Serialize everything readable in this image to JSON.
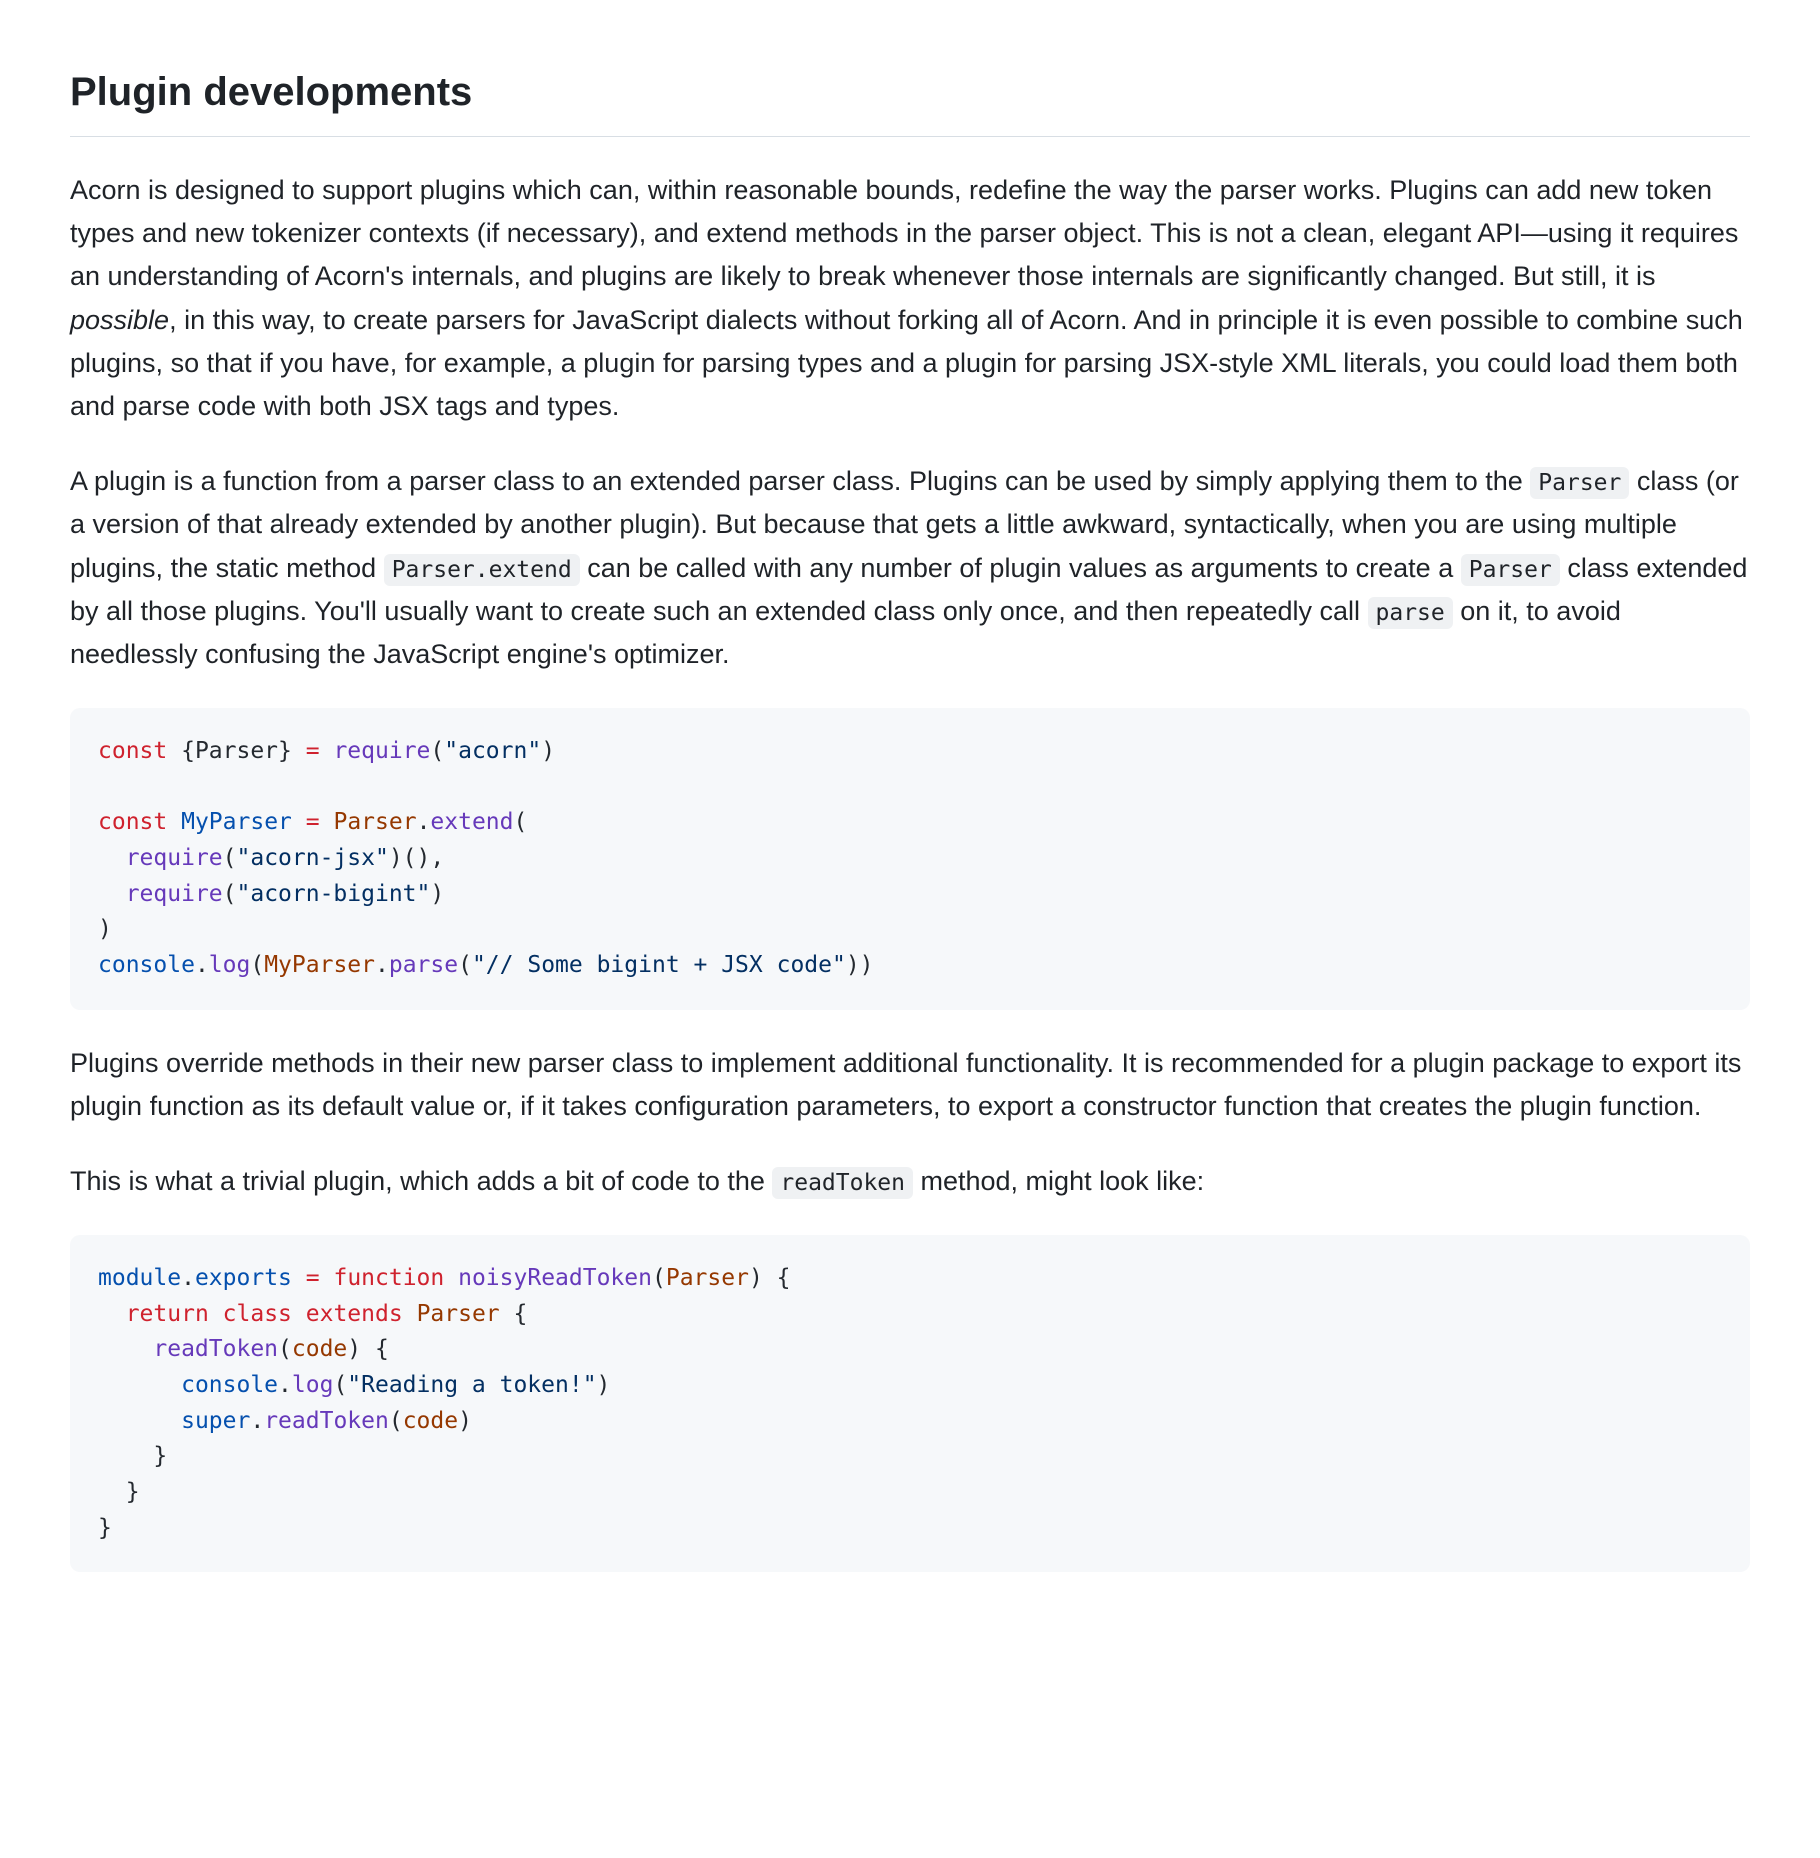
{
  "heading": "Plugin developments",
  "p1a": "Acorn is designed to support plugins which can, within reasonable bounds, redefine the way the parser works. Plugins can add new token types and new tokenizer contexts (if necessary), and extend methods in the parser object. This is not a clean, elegant API—using it requires an understanding of Acorn's internals, and plugins are likely to break whenever those internals are significantly changed. But still, it is ",
  "p1em": "possible",
  "p1b": ", in this way, to create parsers for JavaScript dialects without forking all of Acorn. And in principle it is even possible to combine such plugins, so that if you have, for example, a plugin for parsing types and a plugin for parsing JSX-style XML literals, you could load them both and parse code with both JSX tags and types.",
  "p2a": "A plugin is a function from a parser class to an extended parser class. Plugins can be used by simply applying them to the ",
  "p2code1": "Parser",
  "p2b": " class (or a version of that already extended by another plugin). But because that gets a little awkward, syntactically, when you are using multiple plugins, the static method ",
  "p2code2": "Parser.extend",
  "p2c": " can be called with any number of plugin values as arguments to create a ",
  "p2code3": "Parser",
  "p2d": " class extended by all those plugins. You'll usually want to create such an extended class only once, and then repeatedly call ",
  "p2code4": "parse",
  "p2e": " on it, to avoid needlessly confusing the JavaScript engine's optimizer.",
  "code1": {
    "t0": "const",
    "t1": " {Parser} ",
    "t2": "=",
    "t3": " ",
    "t4": "require",
    "t5": "(",
    "t6": "\"acorn\"",
    "t7": ")\n\n",
    "t8": "const",
    "t9": " ",
    "t10": "MyParser",
    "t11": " ",
    "t12": "=",
    "t13": " ",
    "t14": "Parser",
    "t15": ".",
    "t16": "extend",
    "t17": "(\n  ",
    "t18": "require",
    "t19": "(",
    "t20": "\"acorn-jsx\"",
    "t21": ")(),\n  ",
    "t22": "require",
    "t23": "(",
    "t24": "\"acorn-bigint\"",
    "t25": ")\n)\n",
    "t26": "console",
    "t27": ".",
    "t28": "log",
    "t29": "(",
    "t30": "MyParser",
    "t31": ".",
    "t32": "parse",
    "t33": "(",
    "t34": "\"// Some bigint + JSX code\"",
    "t35": "))"
  },
  "p3": "Plugins override methods in their new parser class to implement additional functionality. It is recommended for a plugin package to export its plugin function as its default value or, if it takes configuration parameters, to export a constructor function that creates the plugin function.",
  "p4a": "This is what a trivial plugin, which adds a bit of code to the ",
  "p4code1": "readToken",
  "p4b": " method, might look like:",
  "code2": {
    "t0": "module",
    "t1": ".",
    "t2": "exports",
    "t3": " ",
    "t4": "=",
    "t5": " ",
    "t6": "function",
    "t7": " ",
    "t8": "noisyReadToken",
    "t9": "(",
    "t10": "Parser",
    "t11": ") {\n  ",
    "t12": "return",
    "t13": " ",
    "t14": "class",
    "t15": " ",
    "t16": "extends",
    "t17": " ",
    "t18": "Parser",
    "t19": " {\n    ",
    "t20": "readToken",
    "t21": "(",
    "t22": "code",
    "t23": ") {\n      ",
    "t24": "console",
    "t25": ".",
    "t26": "log",
    "t27": "(",
    "t28": "\"Reading a token!\"",
    "t29": ")\n      ",
    "t30": "super",
    "t31": ".",
    "t32": "readToken",
    "t33": "(",
    "t34": "code",
    "t35": ")\n    }\n  }\n}"
  }
}
